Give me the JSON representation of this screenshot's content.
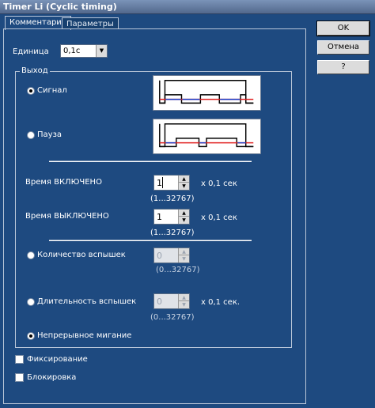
{
  "window": {
    "title": "Timer Li (Cyclic timing)"
  },
  "tabs": [
    {
      "label": "Комментарии",
      "active": true
    },
    {
      "label": "Параметры",
      "active": false
    }
  ],
  "buttons": {
    "ok": "OK",
    "cancel": "Отмена",
    "help": "?"
  },
  "unit": {
    "label": "Единица",
    "value": "0,1с"
  },
  "output": {
    "title": "Выход",
    "signal": {
      "label": "Сигнал",
      "checked": true
    },
    "pause": {
      "label": "Пауза",
      "checked": false
    }
  },
  "time_on": {
    "label": "Время ВКЛЮЧЕНО",
    "value": "1",
    "unit": "x 0,1 сек",
    "range": "(1...32767)"
  },
  "time_off": {
    "label": "Время ВЫКЛЮЧЕНО",
    "value": "1",
    "unit": "x 0,1 сек",
    "range": "(1...32767)"
  },
  "flash_count": {
    "label": "Количество вспышек",
    "value": "0",
    "range": "(0...32767)"
  },
  "flash_duration": {
    "label": "Длительность вспышек",
    "value": "0",
    "unit": "x 0,1 сек.",
    "range": "(0...32767)"
  },
  "continuous": {
    "label": "Непрерывное мигание",
    "checked": true
  },
  "latching": {
    "label": "Фиксирование",
    "checked": false
  },
  "lock": {
    "label": "Блокировка",
    "checked": false
  },
  "colors": {
    "background": "#1e4a80",
    "diagram_line": "#000000",
    "diagram_red": "#e02020",
    "diagram_blue": "#1a3cc8"
  }
}
